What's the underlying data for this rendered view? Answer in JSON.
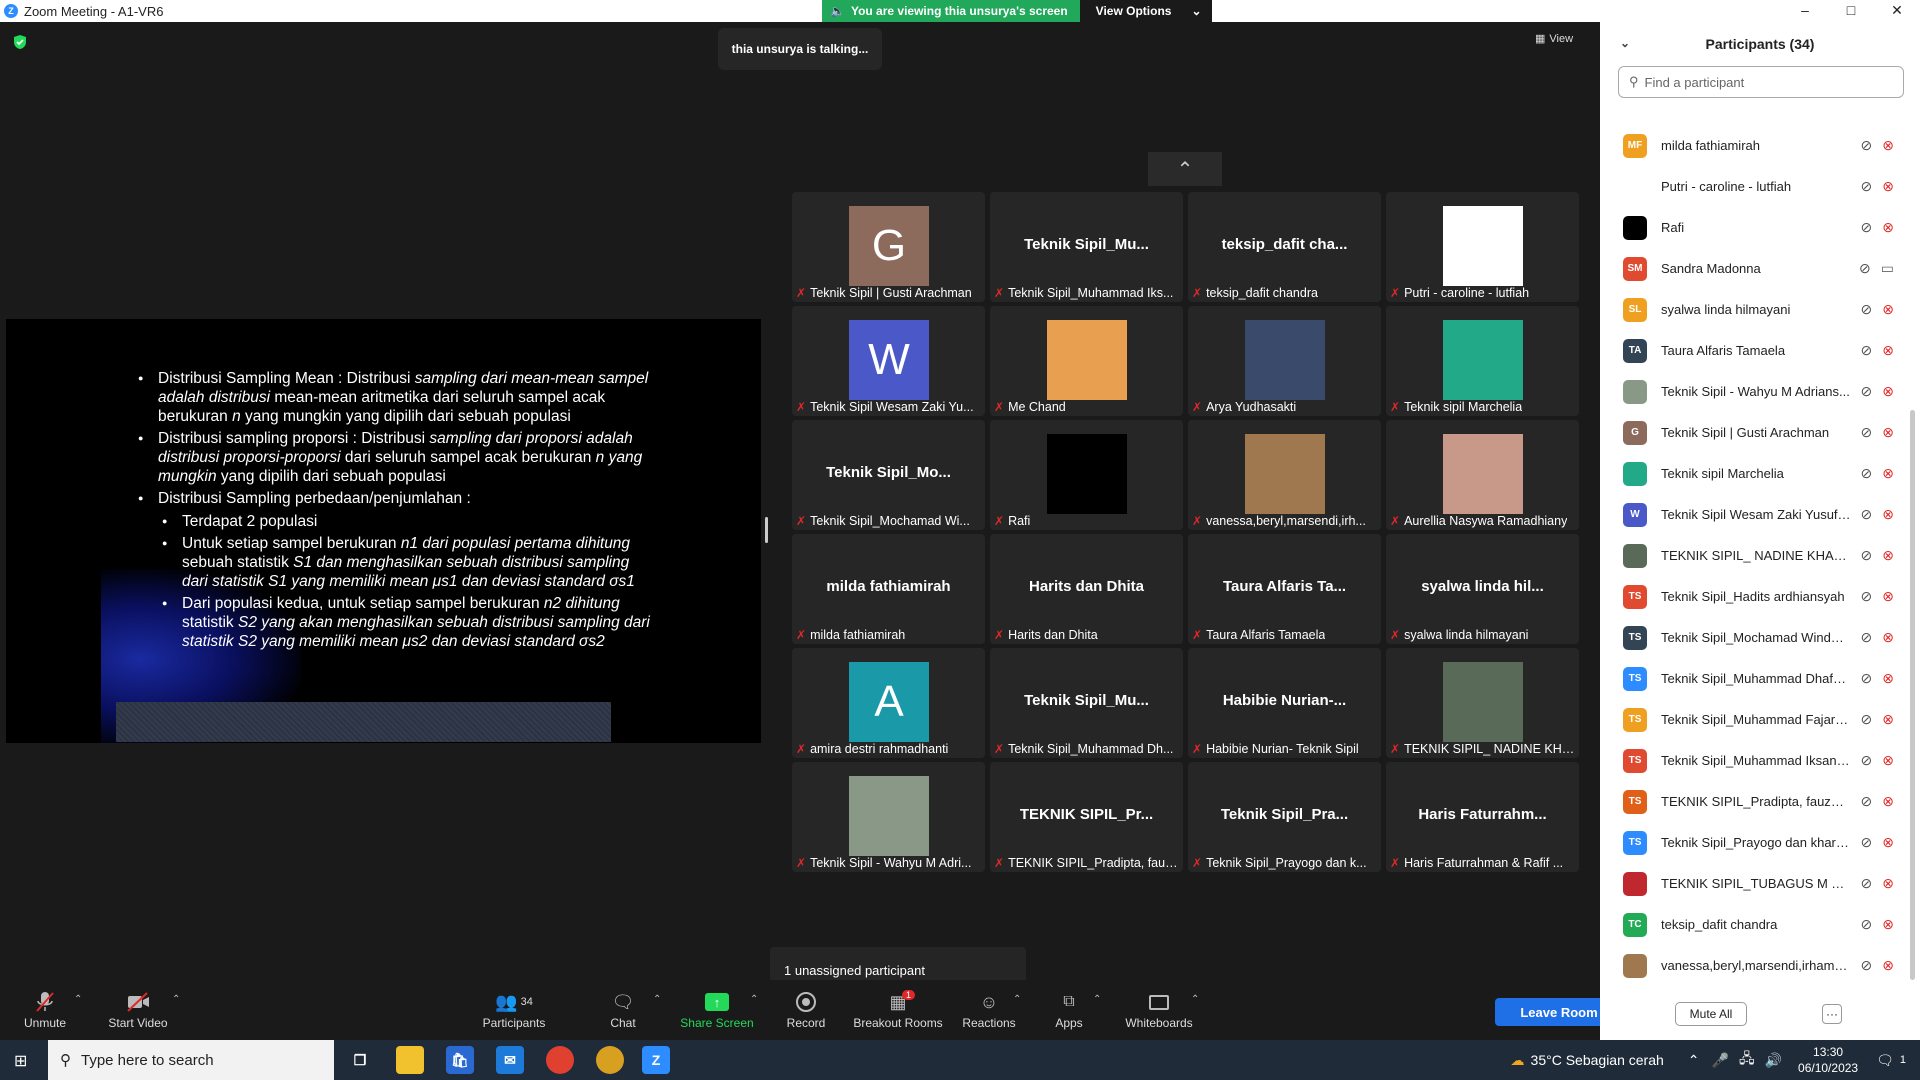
{
  "window": {
    "title": "Zoom Meeting - A1-VR6"
  },
  "share_banner": {
    "text": "You are viewing thia unsurya's screen",
    "view_options": "View Options"
  },
  "talking": "thia unsurya is talking...",
  "view_label": "View",
  "slide": {
    "b1_a": "Distribusi Sampling Mean : Distribusi ",
    "b1_b": "sampling dari mean-mean sampel adalah distribusi",
    "b1_c": " mean-mean aritmetika dari seluruh sampel acak berukuran ",
    "b1_d": "n",
    "b1_e": " yang mungkin yang dipilih dari sebuah populasi",
    "b2_a": "Distribusi sampling proporsi : Distribusi ",
    "b2_b": "sampling dari proporsi adalah distribusi proporsi-proporsi",
    "b2_c": " dari seluruh sampel acak berukuran ",
    "b2_d": "n yang mungkin",
    "b2_e": " yang dipilih dari sebuah populasi",
    "b3": "Distribusi Sampling perbedaan/penjumlahan :",
    "s1": "Terdapat 2 populasi",
    "s2_a": "Untuk setiap sampel berukuran ",
    "s2_b": "n1 dari populasi pertama dihitung",
    "s2_c": " sebuah statistik ",
    "s2_d": "S1 dan menghasilkan sebuah distribusi sampling dari statistik S1 yang memiliki mean μs1 dan deviasi standard σs1",
    "s3_a": "Dari populasi kedua, untuk setiap sampel berukuran ",
    "s3_b": "n2 dihitung",
    "s3_c": " statistik ",
    "s3_d": "S2 yang akan menghasilkan sebuah distribusi sampling dari statistik S2 yang memiliki mean μs2 dan deviasi standard σs2"
  },
  "tiles": [
    {
      "big": "",
      "avatar": "G",
      "avatar_color": "#8c6a5c",
      "caption": "Teknik Sipil | Gusti Arachman"
    },
    {
      "big": "Teknik Sipil_Mu...",
      "avatar": "",
      "avatar_color": "",
      "caption": "Teknik Sipil_Muhammad Iks..."
    },
    {
      "big": "teksip_dafit cha...",
      "avatar": "",
      "avatar_color": "",
      "caption": "teksip_dafit chandra"
    },
    {
      "big": "",
      "avatar": "",
      "avatar_color": "#ffffff",
      "caption": "Putri - caroline - lutfiah"
    },
    {
      "big": "",
      "avatar": "W",
      "avatar_color": "#4a58c8",
      "caption": "Teknik Sipil Wesam Zaki Yu..."
    },
    {
      "big": "",
      "avatar": "",
      "avatar_color": "#e8a050",
      "caption": "Me Chand"
    },
    {
      "big": "",
      "avatar": "",
      "avatar_color": "#3a4a6a",
      "caption": "Arya Yudhasakti"
    },
    {
      "big": "",
      "avatar": "",
      "avatar_color": "#22aa88",
      "caption": "Teknik sipil Marchelia"
    },
    {
      "big": "Teknik Sipil_Mo...",
      "avatar": "",
      "avatar_color": "",
      "caption": "Teknik Sipil_Mochamad Wi..."
    },
    {
      "big": "",
      "avatar": "",
      "avatar_color": "#000000",
      "caption": "Rafi"
    },
    {
      "big": "",
      "avatar": "",
      "avatar_color": "#a07850",
      "caption": "vanessa,beryl,marsendi,irh..."
    },
    {
      "big": "",
      "avatar": "",
      "avatar_color": "#c89888",
      "caption": "Aurellia Nasywa Ramadhiany"
    },
    {
      "big": "milda fathiamirah",
      "avatar": "",
      "avatar_color": "",
      "caption": "milda fathiamirah"
    },
    {
      "big": "Harits dan Dhita",
      "avatar": "",
      "avatar_color": "",
      "caption": "Harits dan Dhita"
    },
    {
      "big": "Taura Alfaris Ta...",
      "avatar": "",
      "avatar_color": "",
      "caption": "Taura Alfaris Tamaela"
    },
    {
      "big": "syalwa linda hil...",
      "avatar": "",
      "avatar_color": "",
      "caption": "syalwa linda hilmayani"
    },
    {
      "big": "",
      "avatar": "A",
      "avatar_color": "#1a9aa8",
      "caption": "amira destri rahmadhanti"
    },
    {
      "big": "Teknik Sipil_Mu...",
      "avatar": "",
      "avatar_color": "",
      "caption": "Teknik Sipil_Muhammad Dh..."
    },
    {
      "big": "Habibie Nurian-...",
      "avatar": "",
      "avatar_color": "",
      "caption": "Habibie Nurian- Teknik Sipil"
    },
    {
      "big": "",
      "avatar": "",
      "avatar_color": "#5a6a58",
      "caption": "TEKNIK SIPIL_ NADINE KHA..."
    },
    {
      "big": "",
      "avatar": "",
      "avatar_color": "#8a9888",
      "caption": "Teknik Sipil - Wahyu M Adri..."
    },
    {
      "big": "TEKNIK SIPIL_Pr...",
      "avatar": "",
      "avatar_color": "",
      "caption": "TEKNIK SIPIL_Pradipta, fauz..."
    },
    {
      "big": "Teknik Sipil_Pra...",
      "avatar": "",
      "avatar_color": "",
      "caption": "Teknik Sipil_Prayogo dan k..."
    },
    {
      "big": "Haris Faturrahm...",
      "avatar": "",
      "avatar_color": "",
      "caption": "Haris Faturrahman & Rafif ..."
    }
  ],
  "unassigned": "1 unassigned participant",
  "toolbar": {
    "unmute": "Unmute",
    "start_video": "Start Video",
    "participants": "Participants",
    "participants_count": "34",
    "chat": "Chat",
    "share_screen": "Share Screen",
    "record": "Record",
    "breakout": "Breakout Rooms",
    "breakout_badge": "1",
    "reactions": "Reactions",
    "apps": "Apps",
    "whiteboards": "Whiteboards",
    "leave": "Leave Room"
  },
  "panel": {
    "title": "Participants (34)",
    "search_placeholder": "Find a participant",
    "mute_all": "Mute All",
    "more": "···",
    "participants": [
      {
        "initials": "MF",
        "color": "#f0a020",
        "name": "milda fathiamirah",
        "video": "off"
      },
      {
        "initials": "",
        "color": "#ffffff",
        "name": "Putri - caroline - lutfiah",
        "video": "off"
      },
      {
        "initials": "",
        "color": "#000000",
        "name": "Rafi",
        "video": "off"
      },
      {
        "initials": "SM",
        "color": "#e04a30",
        "name": "Sandra Madonna",
        "video": "on"
      },
      {
        "initials": "SL",
        "color": "#f0a020",
        "name": "syalwa linda hilmayani",
        "video": "off"
      },
      {
        "initials": "TA",
        "color": "#334455",
        "name": "Taura Alfaris Tamaela",
        "video": "off"
      },
      {
        "initials": "",
        "color": "#8a9888",
        "name": "Teknik Sipil - Wahyu M Adrians...",
        "video": "off"
      },
      {
        "initials": "G",
        "color": "#8c6a5c",
        "name": "Teknik Sipil | Gusti Arachman",
        "video": "off"
      },
      {
        "initials": "",
        "color": "#22aa88",
        "name": "Teknik sipil Marchelia",
        "video": "off"
      },
      {
        "initials": "W",
        "color": "#4a58c8",
        "name": "Teknik Sipil Wesam Zaki Yusuf S...",
        "video": "off"
      },
      {
        "initials": "",
        "color": "#5a6a58",
        "name": "TEKNIK SIPIL_ NADINE KHANSA",
        "video": "off"
      },
      {
        "initials": "TS",
        "color": "#e04a30",
        "name": "Teknik Sipil_Hadits ardhiansyah",
        "video": "off"
      },
      {
        "initials": "TS",
        "color": "#334455",
        "name": "Teknik Sipil_Mochamad Windu ...",
        "video": "off"
      },
      {
        "initials": "TS",
        "color": "#2d8cff",
        "name": "Teknik Sipil_Muhammad Dhafa ...",
        "video": "off"
      },
      {
        "initials": "TS",
        "color": "#f0a020",
        "name": "Teknik Sipil_Muhammad Fajar_FT",
        "video": "off"
      },
      {
        "initials": "TS",
        "color": "#e04a30",
        "name": "Teknik Sipil_Muhammad Iksan ...",
        "video": "off"
      },
      {
        "initials": "TS",
        "color": "#e0601a",
        "name": "TEKNIK SIPIL_Pradipta, fauzan, ...",
        "video": "off"
      },
      {
        "initials": "TS",
        "color": "#2d8cff",
        "name": "Teknik Sipil_Prayogo dan kharis...",
        "video": "off"
      },
      {
        "initials": "",
        "color": "#c02830",
        "name": "TEKNIK SIPIL_TUBAGUS M YUS...",
        "video": "off"
      },
      {
        "initials": "TC",
        "color": "#22aa55",
        "name": "teksip_dafit chandra",
        "video": "off"
      },
      {
        "initials": "",
        "color": "#a07850",
        "name": "vanessa,beryl,marsendi,irham,jati",
        "video": "off"
      }
    ]
  },
  "taskbar": {
    "search_placeholder": "Type here to search",
    "weather": "35°C  Sebagian cerah",
    "time": "13:30",
    "date": "06/10/2023",
    "notif_count": "1"
  }
}
